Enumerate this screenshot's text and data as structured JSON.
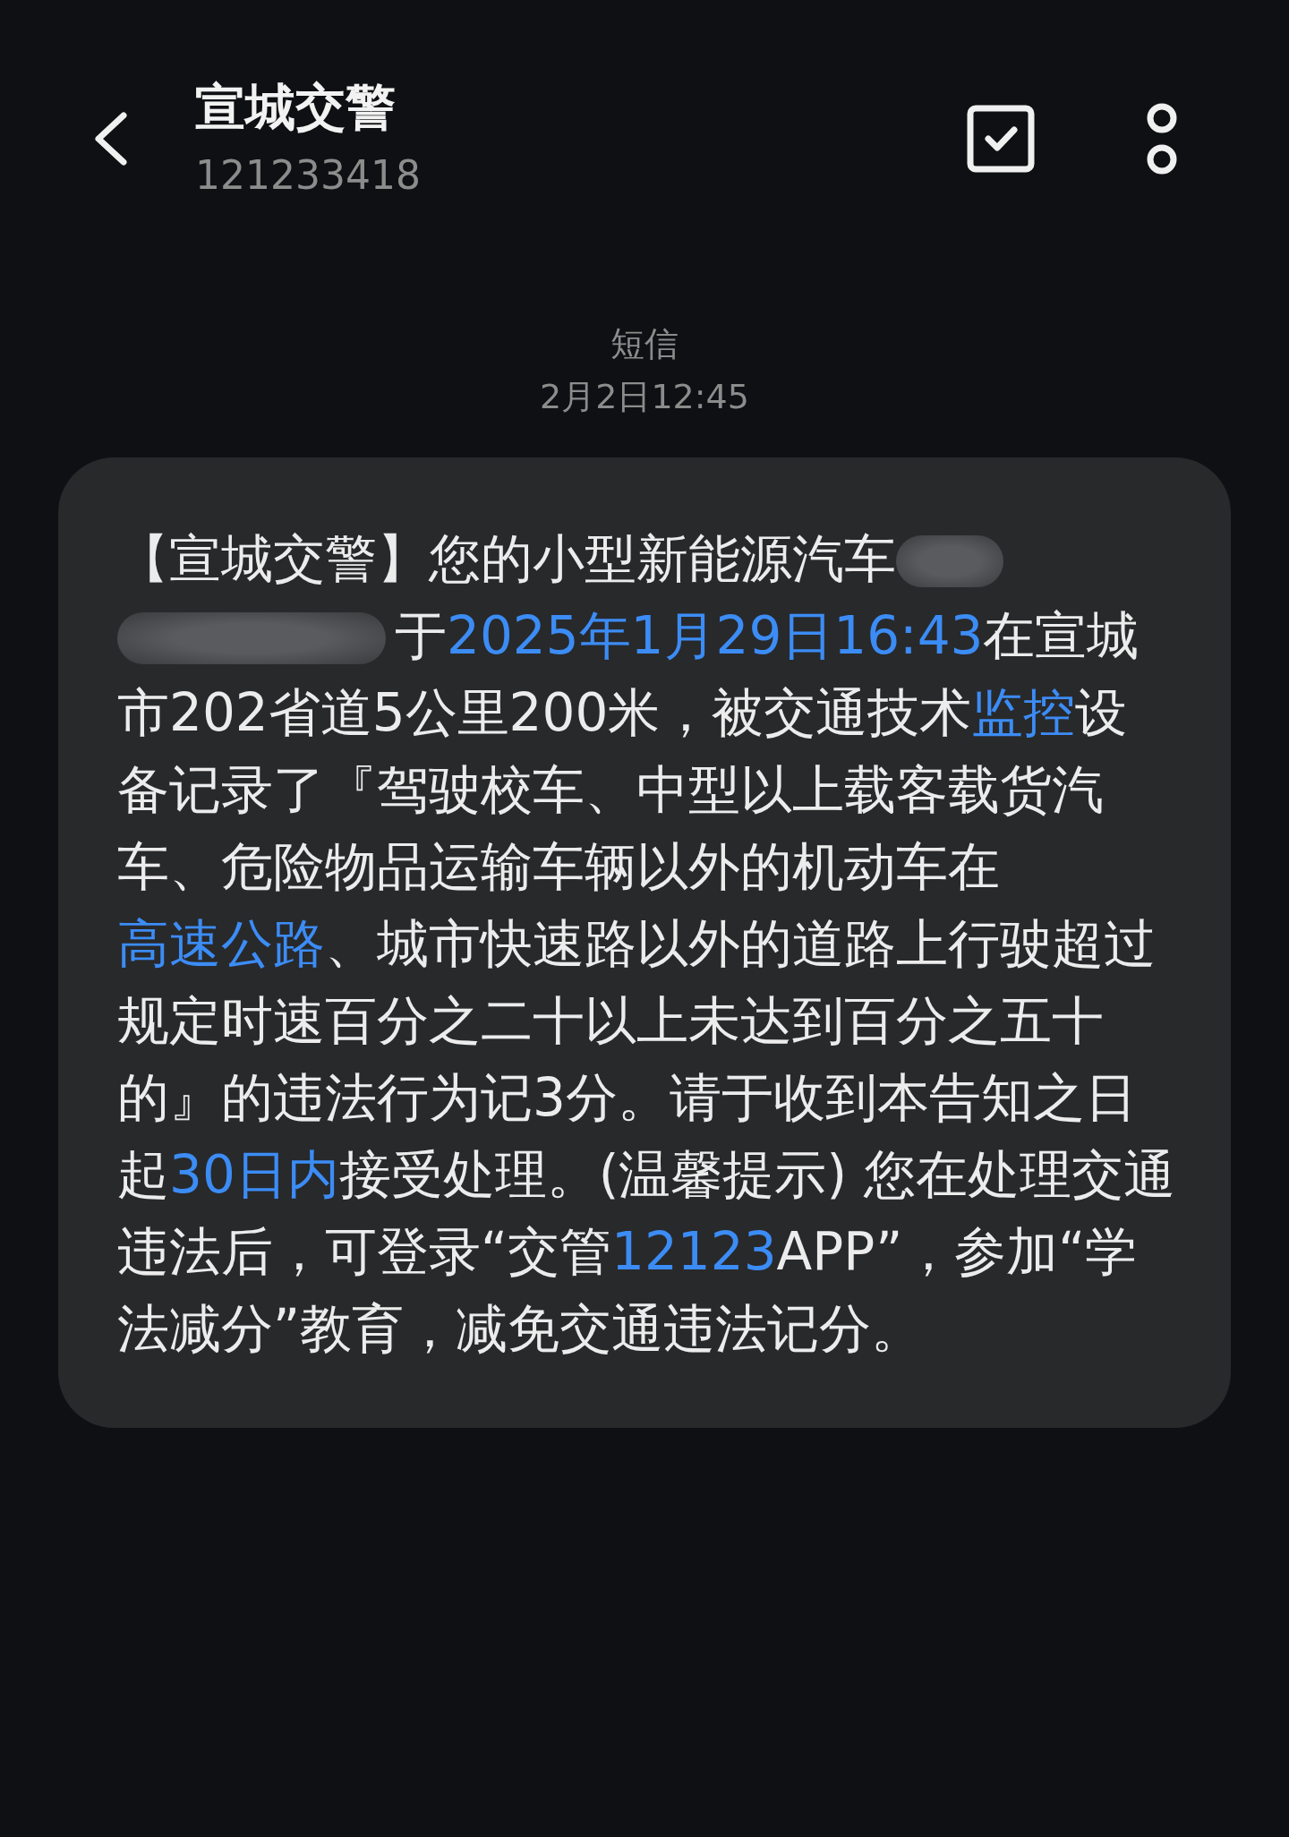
{
  "header": {
    "title": "宣城交警",
    "number": "121233418"
  },
  "timestamp": {
    "channel": "短信",
    "time": "2月2日12:45"
  },
  "message": {
    "segments": [
      {
        "kind": "text",
        "text": "【宣城交警】您的小型新能源汽车"
      },
      {
        "kind": "redacted"
      },
      {
        "kind": "redacted_wide"
      },
      {
        "kind": "text",
        "text": "于"
      },
      {
        "kind": "link",
        "text": "2025年1月29日16:43"
      },
      {
        "kind": "text",
        "text": "在宣城市202省道5公里200米，被交通技术"
      },
      {
        "kind": "link",
        "text": "监控"
      },
      {
        "kind": "text",
        "text": "设备记录了『驾驶校车、中型以上载客载货汽车、危险物品运输车辆以外的机动车在"
      },
      {
        "kind": "link",
        "text": "高速公路"
      },
      {
        "kind": "text",
        "text": "、城市快速路以外的道路上行驶超过规定时速百分之二十以上未达到百分之五十的』的违法行为记3分。请于收到本告知之日起"
      },
      {
        "kind": "link",
        "text": "30日内"
      },
      {
        "kind": "text",
        "text": "接受处理。(温馨提示) 您在处理交通违法后，可登录“交管"
      },
      {
        "kind": "link",
        "text": "12123"
      },
      {
        "kind": "text",
        "text": "APP”，参加“学法减分”教育，减免交通违法记分。"
      }
    ]
  }
}
